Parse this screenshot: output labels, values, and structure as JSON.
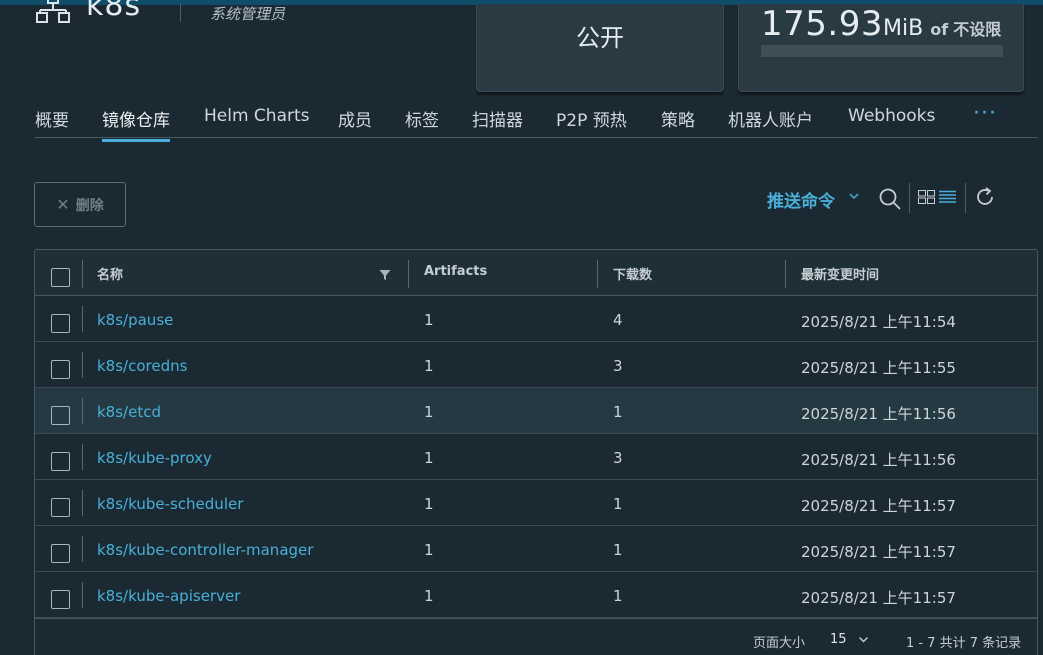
{
  "project": {
    "name": "k8s",
    "role": "系统管理员"
  },
  "cards": {
    "access_level": "公开",
    "quota_used_value": "175.93",
    "quota_used_unit": "MiB",
    "quota_of": "of",
    "quota_limit": "不设限"
  },
  "tabs": [
    {
      "label": "概要"
    },
    {
      "label": "镜像仓库"
    },
    {
      "label": "Helm Charts"
    },
    {
      "label": "成员"
    },
    {
      "label": "标签"
    },
    {
      "label": "扫描器"
    },
    {
      "label": "P2P 预热"
    },
    {
      "label": "策略"
    },
    {
      "label": "机器人账户"
    },
    {
      "label": "Webhooks"
    }
  ],
  "tabs_more": "···",
  "toolbar": {
    "delete_label": "删除",
    "push_command_label": "推送命令"
  },
  "table": {
    "columns": {
      "name": "名称",
      "artifacts": "Artifacts",
      "downloads": "下载数",
      "updated": "最新变更时间"
    },
    "rows": [
      {
        "name": "k8s/pause",
        "artifacts": "1",
        "downloads": "4",
        "updated": "2025/8/21 上午11:54"
      },
      {
        "name": "k8s/coredns",
        "artifacts": "1",
        "downloads": "3",
        "updated": "2025/8/21 上午11:55"
      },
      {
        "name": "k8s/etcd",
        "artifacts": "1",
        "downloads": "1",
        "updated": "2025/8/21 上午11:56"
      },
      {
        "name": "k8s/kube-proxy",
        "artifacts": "1",
        "downloads": "3",
        "updated": "2025/8/21 上午11:56"
      },
      {
        "name": "k8s/kube-scheduler",
        "artifacts": "1",
        "downloads": "1",
        "updated": "2025/8/21 上午11:57"
      },
      {
        "name": "k8s/kube-controller-manager",
        "artifacts": "1",
        "downloads": "1",
        "updated": "2025/8/21 上午11:57"
      },
      {
        "name": "k8s/kube-apiserver",
        "artifacts": "1",
        "downloads": "1",
        "updated": "2025/8/21 上午11:57"
      }
    ]
  },
  "footer": {
    "page_size_label": "页面大小",
    "page_size_value": "15",
    "summary": "1 - 7 共计 7 条记录"
  },
  "colors": {
    "accent": "#49afd9",
    "background": "#1b2a32",
    "card": "#2a3a43"
  }
}
